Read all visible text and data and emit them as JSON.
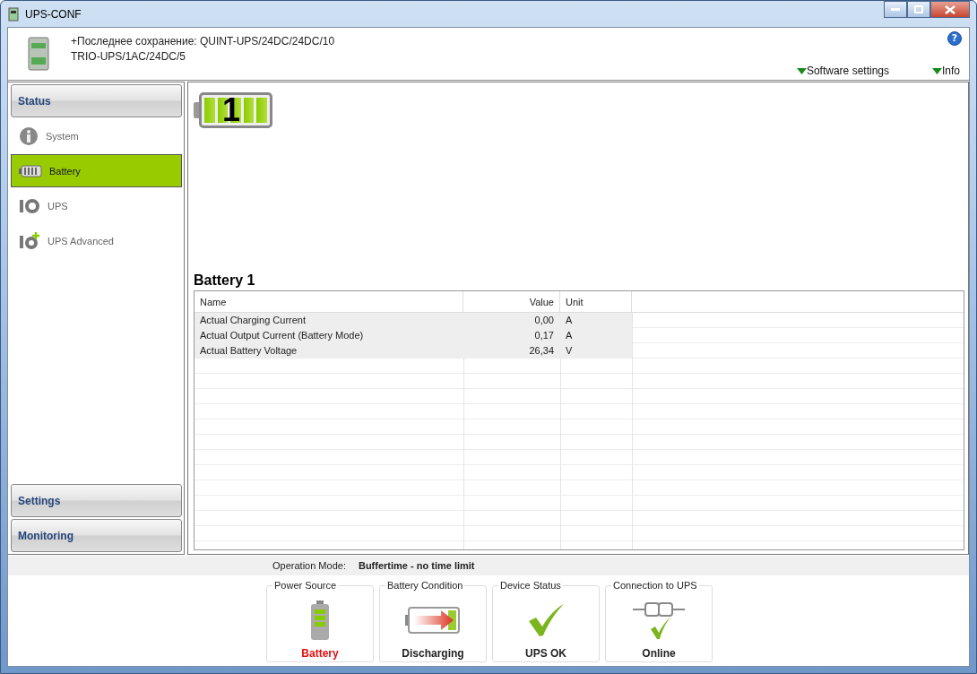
{
  "window": {
    "title": "UPS-CONF"
  },
  "header": {
    "lines": [
      "+Последнее сохранение: QUINT-UPS/24DC/24DC/10",
      "TRIO-UPS/1AC/24DC/5"
    ],
    "links": [
      "Software settings",
      "Info"
    ],
    "help": "?"
  },
  "sidebar": {
    "sections": [
      {
        "label": "Status",
        "items": [
          {
            "label": "System",
            "kind": "info",
            "selected": false
          },
          {
            "label": "Battery",
            "kind": "battery",
            "selected": true
          },
          {
            "label": "UPS",
            "kind": "iq",
            "selected": false
          },
          {
            "label": "UPS Advanced",
            "kind": "iqplus",
            "selected": false
          }
        ]
      },
      {
        "label": "Settings"
      },
      {
        "label": "Monitoring"
      }
    ]
  },
  "battery_badge": "1",
  "panel": {
    "title": "Battery 1",
    "table": {
      "columns": [
        "Name",
        "Value",
        "Unit"
      ],
      "rows": [
        [
          "Actual Charging Current",
          "0,00",
          "A"
        ],
        [
          "Actual Output Current (Battery Mode)",
          "0,17",
          "A"
        ],
        [
          "Actual Battery Voltage",
          "26,34",
          "V"
        ]
      ]
    }
  },
  "operation_mode": {
    "label": "Operation Mode:",
    "value": "Buffertime - no time limit"
  },
  "status_cards": [
    {
      "title": "Power Source",
      "value": "Battery",
      "kind": "battery",
      "alert": true
    },
    {
      "title": "Battery Condition",
      "value": "Discharging",
      "kind": "discharging",
      "alert": false
    },
    {
      "title": "Device Status",
      "value": "UPS OK",
      "kind": "check",
      "alert": false
    },
    {
      "title": "Connection to UPS",
      "value": "Online",
      "kind": "connection",
      "alert": false
    }
  ]
}
